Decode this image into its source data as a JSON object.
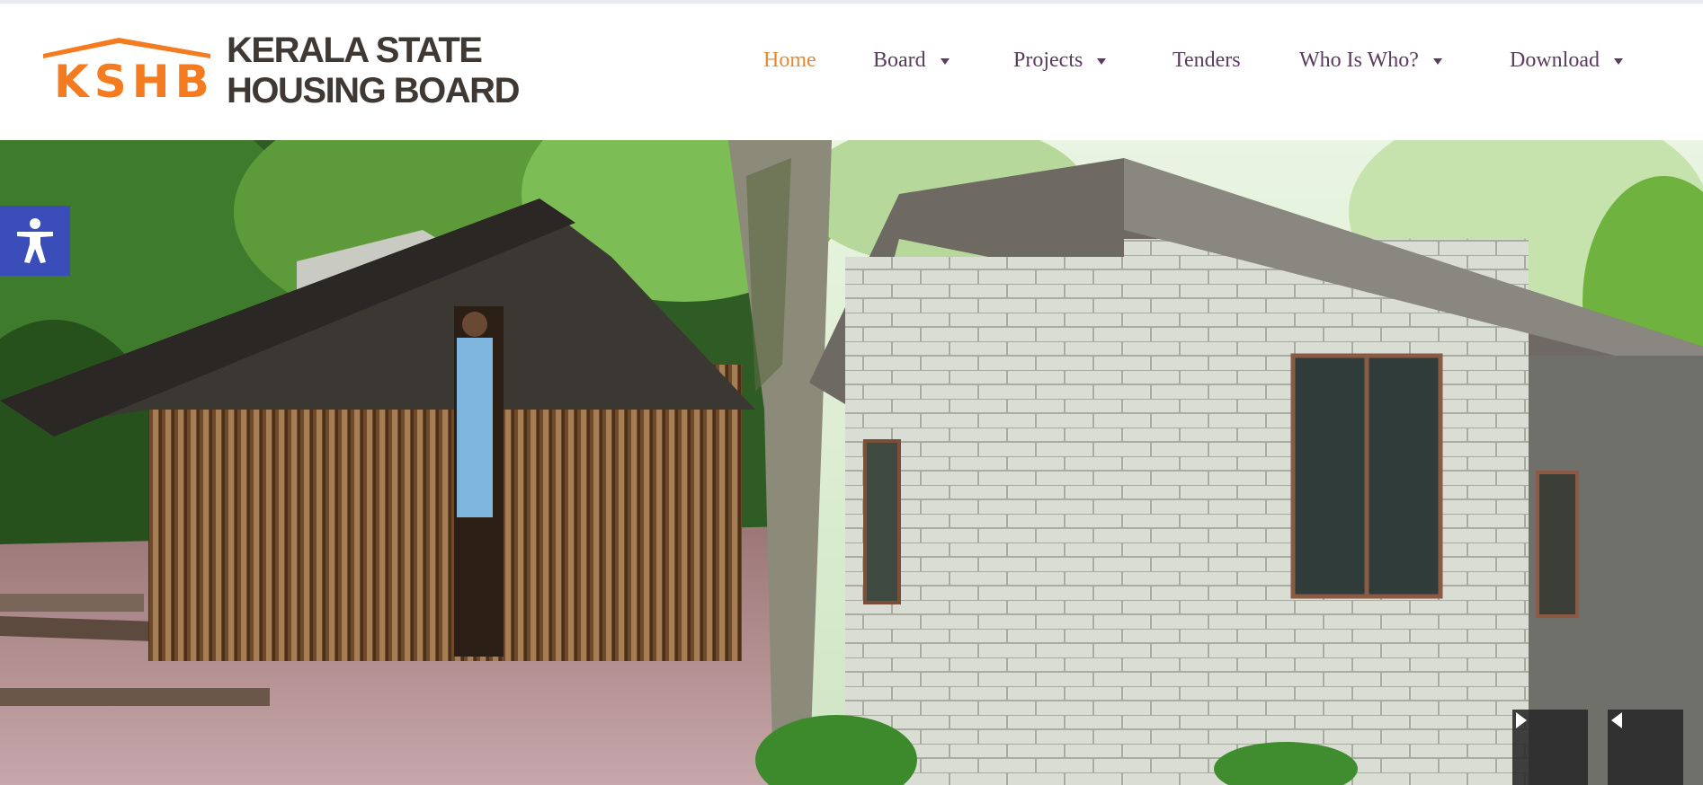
{
  "brand": {
    "logo_mark_text": "KSHB",
    "name_line1": "KERALA STATE",
    "name_line2": "HOUSING BOARD",
    "logo_color": "#f47b20"
  },
  "nav": {
    "items": [
      {
        "label": "Home",
        "active": true,
        "has_dropdown": false
      },
      {
        "label": "Board",
        "active": false,
        "has_dropdown": true
      },
      {
        "label": "Projects",
        "active": false,
        "has_dropdown": true
      },
      {
        "label": "Tenders",
        "active": false,
        "has_dropdown": false
      },
      {
        "label": "Who Is Who?",
        "active": false,
        "has_dropdown": true
      },
      {
        "label": "Download",
        "active": false,
        "has_dropdown": true
      }
    ],
    "active_color": "#e8892f",
    "text_color": "#5b3b5f"
  },
  "accessibility": {
    "icon": "accessibility-person-icon",
    "color": "#3b4db8"
  },
  "slider": {
    "next_icon": "caret-right-icon",
    "prev_icon": "caret-left-icon"
  }
}
